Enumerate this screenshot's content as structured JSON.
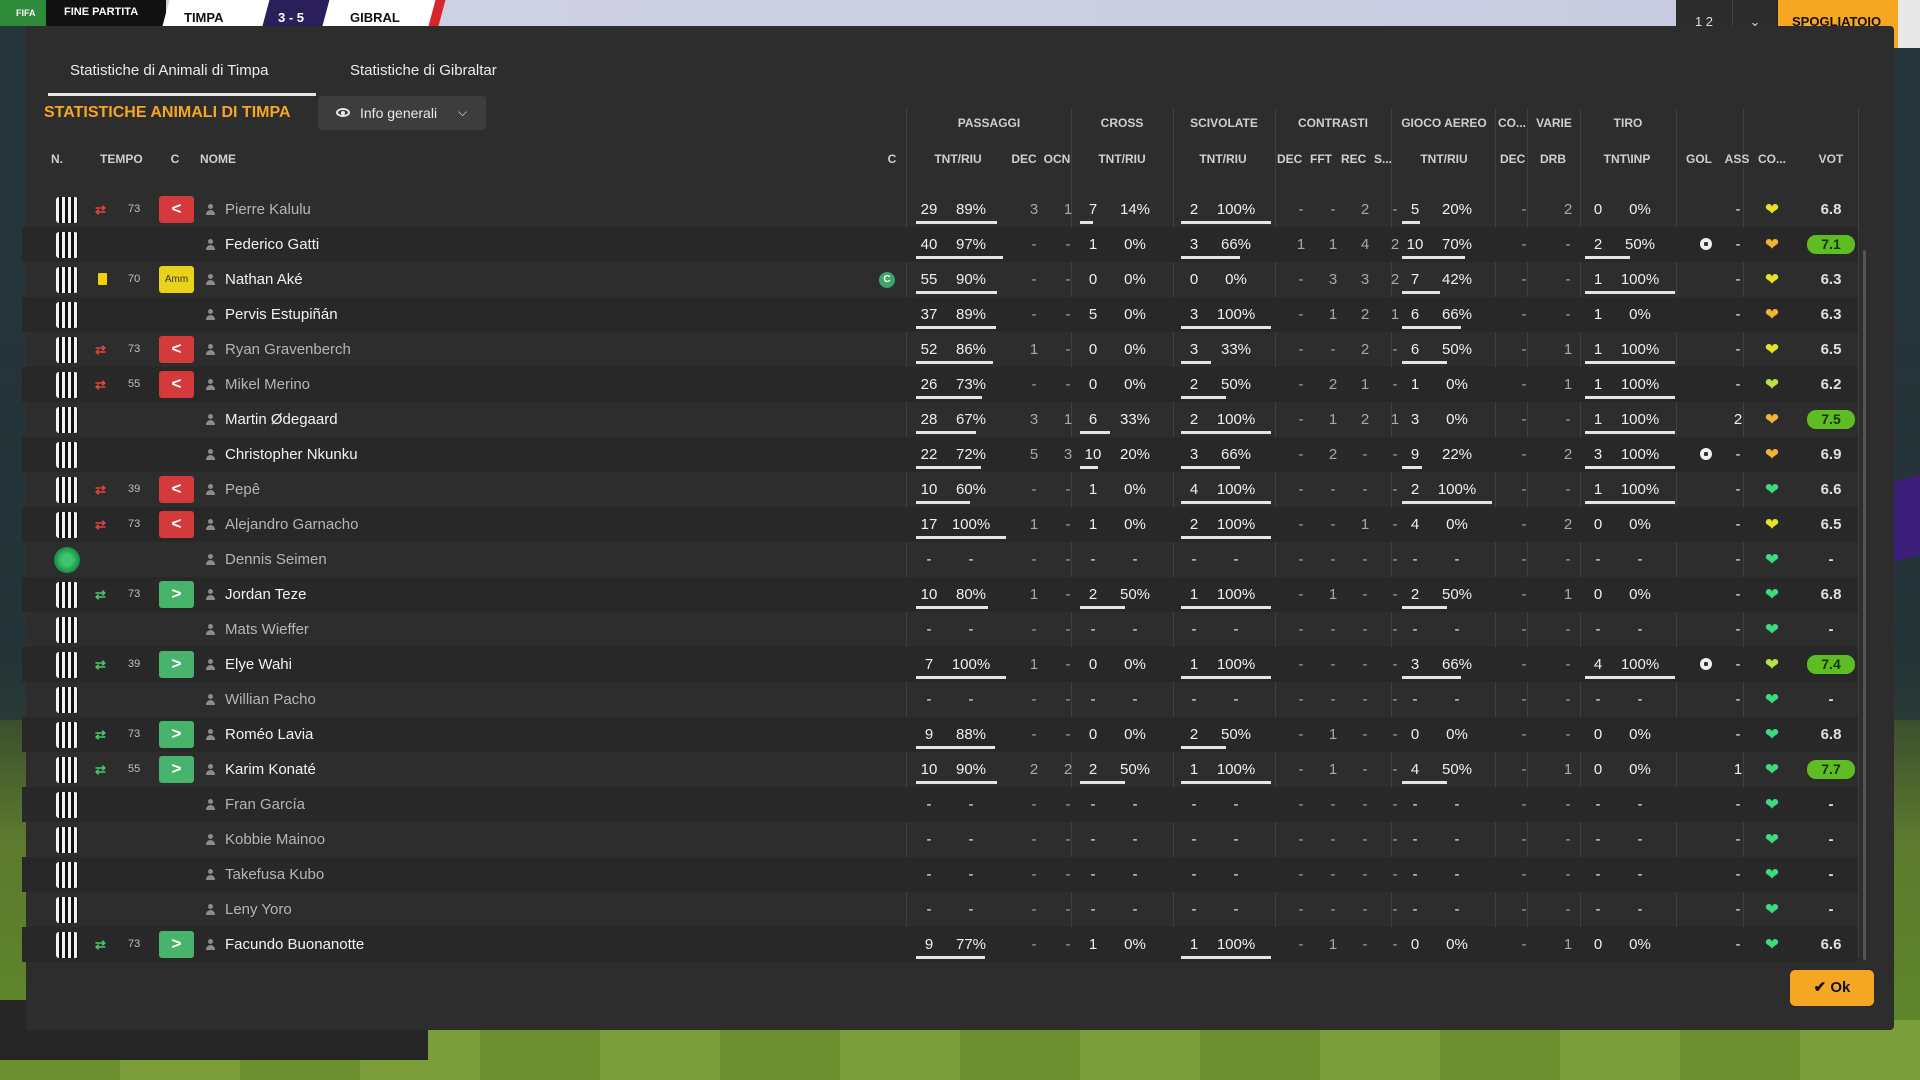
{
  "topbar": {
    "left_label": "FINE PARTITA",
    "fifa_label": "FIFA",
    "home_abbr": "TIMPA",
    "score": "3 - 5",
    "away_abbr": "GIBRAL",
    "right_box1": "1 2",
    "right_box2": "⌄",
    "orange_label": "SPOGLIATOIO"
  },
  "tabs": [
    {
      "label": "Statistiche di Animali di Timpa",
      "active": true
    },
    {
      "label": "Statistiche di Gibraltar",
      "active": false
    }
  ],
  "title": "STATISTICHE ANIMALI DI TIMPA",
  "view_dropdown": {
    "label": "Info generali",
    "icon": "eye-icon"
  },
  "groups": [
    "PASSAGGI",
    "CROSS",
    "SCIVOLATE",
    "CONTRASTI",
    "GIOCO AEREO",
    "CO...",
    "VARIE",
    "TIRO"
  ],
  "headers": {
    "n": "N.",
    "tempo": "TEMPO",
    "c": "C",
    "nome": "NOME",
    "c2": "C",
    "pass_tnt": "TNT/RIU",
    "dec": "DEC",
    "ocn": "OCN",
    "cross_tnt": "TNT/RIU",
    "sciv_tnt": "TNT/RIU",
    "con_dec": "DEC",
    "fft": "FFT",
    "rec": "REC",
    "s": "S...",
    "aereo_tnt": "TNT/RIU",
    "co_dec": "DEC",
    "drb": "DRB",
    "tiro": "TNT\\INP",
    "gol": "GOL",
    "ass": "ASS",
    "co": "CO...",
    "vot": "VOT"
  },
  "colors": {
    "accent": "#f5a623",
    "sub_out": "#d4393c",
    "sub_in": "#48b36a",
    "rating_hi": "#5fbd24"
  },
  "players": [
    {
      "name": "Pierre Kalulu",
      "sub": "out",
      "min": "73",
      "badge": "<",
      "card": "",
      "cap": false,
      "p": [
        "29",
        "89%"
      ],
      "dec": "3",
      "ocn": "1",
      "cr": [
        "7",
        "14%"
      ],
      "sc": [
        "2",
        "100%"
      ],
      "ct": [
        "-",
        "-",
        "2",
        "-"
      ],
      "ae": [
        "5",
        "20%"
      ],
      "codec": "-",
      "drb": "2",
      "ti": [
        "0",
        "0%"
      ],
      "gol": "",
      "ass": "-",
      "heart": "yellow",
      "vot": "6.8",
      "hi": false,
      "pb": 0.9,
      "cb": 0.14,
      "sb": 1,
      "ab": 0.2,
      "tb": 0,
      "kit": "stripes"
    },
    {
      "name": "Federico Gatti",
      "sub": "",
      "min": "",
      "badge": "",
      "card": "",
      "cap": false,
      "p": [
        "40",
        "97%"
      ],
      "dec": "-",
      "ocn": "-",
      "cr": [
        "1",
        "0%"
      ],
      "sc": [
        "3",
        "66%"
      ],
      "ct": [
        "1",
        "1",
        "4",
        "2"
      ],
      "ae": [
        "10",
        "70%"
      ],
      "codec": "-",
      "drb": "-",
      "ti": [
        "2",
        "50%"
      ],
      "gol": "ball",
      "ass": "-",
      "heart": "orange",
      "vot": "7.1",
      "hi": true,
      "pb": 0.97,
      "cb": 0,
      "sb": 0.66,
      "ab": 0.7,
      "tb": 0.5,
      "kit": "stripes"
    },
    {
      "name": "Nathan Aké",
      "sub": "",
      "min": "70",
      "badge": "Amm",
      "card": "yellow",
      "cap": true,
      "p": [
        "55",
        "90%"
      ],
      "dec": "-",
      "ocn": "-",
      "cr": [
        "0",
        "0%"
      ],
      "sc": [
        "0",
        "0%"
      ],
      "ct": [
        "-",
        "3",
        "3",
        "2"
      ],
      "ae": [
        "7",
        "42%"
      ],
      "codec": "-",
      "drb": "-",
      "ti": [
        "1",
        "100%"
      ],
      "gol": "",
      "ass": "-",
      "heart": "yellow",
      "vot": "6.3",
      "hi": false,
      "pb": 0.9,
      "cb": 0,
      "sb": 0,
      "ab": 0.42,
      "tb": 1,
      "kit": "stripes"
    },
    {
      "name": "Pervis Estupiñán",
      "sub": "",
      "min": "",
      "badge": "",
      "card": "",
      "cap": false,
      "p": [
        "37",
        "89%"
      ],
      "dec": "-",
      "ocn": "-",
      "cr": [
        "5",
        "0%"
      ],
      "sc": [
        "3",
        "100%"
      ],
      "ct": [
        "-",
        "1",
        "2",
        "1"
      ],
      "ae": [
        "6",
        "66%"
      ],
      "codec": "-",
      "drb": "-",
      "ti": [
        "1",
        "0%"
      ],
      "gol": "",
      "ass": "-",
      "heart": "orange",
      "vot": "6.3",
      "hi": false,
      "pb": 0.89,
      "cb": 0,
      "sb": 1,
      "ab": 0.66,
      "tb": 0,
      "kit": "stripes"
    },
    {
      "name": "Ryan Gravenberch",
      "sub": "out",
      "min": "73",
      "badge": "<",
      "card": "",
      "cap": false,
      "p": [
        "52",
        "86%"
      ],
      "dec": "1",
      "ocn": "-",
      "cr": [
        "0",
        "0%"
      ],
      "sc": [
        "3",
        "33%"
      ],
      "ct": [
        "-",
        "-",
        "2",
        "-"
      ],
      "ae": [
        "6",
        "50%"
      ],
      "codec": "-",
      "drb": "1",
      "ti": [
        "1",
        "100%"
      ],
      "gol": "",
      "ass": "-",
      "heart": "yellow",
      "vot": "6.5",
      "hi": false,
      "pb": 0.86,
      "cb": 0,
      "sb": 0.33,
      "ab": 0.5,
      "tb": 1,
      "kit": "stripes"
    },
    {
      "name": "Mikel Merino",
      "sub": "out",
      "min": "55",
      "badge": "<",
      "card": "",
      "cap": false,
      "p": [
        "26",
        "73%"
      ],
      "dec": "-",
      "ocn": "-",
      "cr": [
        "0",
        "0%"
      ],
      "sc": [
        "2",
        "50%"
      ],
      "ct": [
        "-",
        "2",
        "1",
        "-"
      ],
      "ae": [
        "1",
        "0%"
      ],
      "codec": "-",
      "drb": "1",
      "ti": [
        "1",
        "100%"
      ],
      "gol": "",
      "ass": "-",
      "heart": "yellowgreen",
      "vot": "6.2",
      "hi": false,
      "pb": 0.73,
      "cb": 0,
      "sb": 0.5,
      "ab": 0,
      "tb": 1,
      "kit": "stripes"
    },
    {
      "name": "Martin Ødegaard",
      "sub": "",
      "min": "",
      "badge": "",
      "card": "",
      "cap": false,
      "p": [
        "28",
        "67%"
      ],
      "dec": "3",
      "ocn": "1",
      "cr": [
        "6",
        "33%"
      ],
      "sc": [
        "2",
        "100%"
      ],
      "ct": [
        "-",
        "1",
        "2",
        "1"
      ],
      "ae": [
        "3",
        "0%"
      ],
      "codec": "-",
      "drb": "-",
      "ti": [
        "1",
        "100%"
      ],
      "gol": "",
      "ass": "2",
      "heart": "orange",
      "vot": "7.5",
      "hi": true,
      "pb": 0.67,
      "cb": 0.33,
      "sb": 1,
      "ab": 0,
      "tb": 1,
      "kit": "stripes"
    },
    {
      "name": "Christopher Nkunku",
      "sub": "",
      "min": "",
      "badge": "",
      "card": "",
      "cap": false,
      "p": [
        "22",
        "72%"
      ],
      "dec": "5",
      "ocn": "3",
      "cr": [
        "10",
        "20%"
      ],
      "sc": [
        "3",
        "66%"
      ],
      "ct": [
        "-",
        "2",
        "-",
        "-"
      ],
      "ae": [
        "9",
        "22%"
      ],
      "codec": "-",
      "drb": "2",
      "ti": [
        "3",
        "100%"
      ],
      "gol": "ball",
      "ass": "-",
      "heart": "orange",
      "vot": "6.9",
      "hi": false,
      "pb": 0.72,
      "cb": 0.2,
      "sb": 0.66,
      "ab": 0.22,
      "tb": 1,
      "kit": "stripes"
    },
    {
      "name": "Pepê",
      "sub": "out",
      "min": "39",
      "badge": "<",
      "card": "",
      "cap": false,
      "p": [
        "10",
        "60%"
      ],
      "dec": "-",
      "ocn": "-",
      "cr": [
        "1",
        "0%"
      ],
      "sc": [
        "4",
        "100%"
      ],
      "ct": [
        "-",
        "-",
        "-",
        "-"
      ],
      "ae": [
        "2",
        "100%"
      ],
      "codec": "-",
      "drb": "-",
      "ti": [
        "1",
        "100%"
      ],
      "gol": "",
      "ass": "-",
      "heart": "green",
      "vot": "6.6",
      "hi": false,
      "pb": 0.6,
      "cb": 0,
      "sb": 1,
      "ab": 1,
      "tb": 1,
      "kit": "stripes"
    },
    {
      "name": "Alejandro Garnacho",
      "sub": "out",
      "min": "73",
      "badge": "<",
      "card": "",
      "cap": false,
      "p": [
        "17",
        "100%"
      ],
      "dec": "1",
      "ocn": "-",
      "cr": [
        "1",
        "0%"
      ],
      "sc": [
        "2",
        "100%"
      ],
      "ct": [
        "-",
        "-",
        "1",
        "-"
      ],
      "ae": [
        "4",
        "0%"
      ],
      "codec": "-",
      "drb": "2",
      "ti": [
        "0",
        "0%"
      ],
      "gol": "",
      "ass": "-",
      "heart": "yellow",
      "vot": "6.5",
      "hi": false,
      "pb": 1,
      "cb": 0,
      "sb": 1,
      "ab": 0,
      "tb": 0,
      "kit": "stripes"
    },
    {
      "name": "Dennis Seimen",
      "sub": "",
      "min": "",
      "badge": "",
      "card": "",
      "cap": false,
      "p": [
        "-",
        "-"
      ],
      "dec": "-",
      "ocn": "-",
      "cr": [
        "-",
        "-"
      ],
      "sc": [
        "-",
        "-"
      ],
      "ct": [
        "-",
        "-",
        "-",
        "-"
      ],
      "ae": [
        "-",
        "-"
      ],
      "codec": "-",
      "drb": "-",
      "ti": [
        "-",
        "-"
      ],
      "gol": "",
      "ass": "-",
      "heart": "green",
      "vot": "-",
      "hi": false,
      "pb": 0,
      "cb": 0,
      "sb": 0,
      "ab": 0,
      "tb": 0,
      "kit": "gk",
      "dimname": true
    },
    {
      "name": "Jordan Teze",
      "sub": "in",
      "min": "73",
      "badge": ">",
      "card": "",
      "cap": false,
      "p": [
        "10",
        "80%"
      ],
      "dec": "1",
      "ocn": "-",
      "cr": [
        "2",
        "50%"
      ],
      "sc": [
        "1",
        "100%"
      ],
      "ct": [
        "-",
        "1",
        "-",
        "-"
      ],
      "ae": [
        "2",
        "50%"
      ],
      "codec": "-",
      "drb": "1",
      "ti": [
        "0",
        "0%"
      ],
      "gol": "",
      "ass": "-",
      "heart": "green",
      "vot": "6.8",
      "hi": false,
      "pb": 0.8,
      "cb": 0.5,
      "sb": 1,
      "ab": 0.5,
      "tb": 0,
      "kit": "stripes"
    },
    {
      "name": "Mats Wieffer",
      "sub": "",
      "min": "",
      "badge": "",
      "card": "",
      "cap": false,
      "p": [
        "-",
        "-"
      ],
      "dec": "-",
      "ocn": "-",
      "cr": [
        "-",
        "-"
      ],
      "sc": [
        "-",
        "-"
      ],
      "ct": [
        "-",
        "-",
        "-",
        "-"
      ],
      "ae": [
        "-",
        "-"
      ],
      "codec": "-",
      "drb": "-",
      "ti": [
        "-",
        "-"
      ],
      "gol": "",
      "ass": "-",
      "heart": "green",
      "vot": "-",
      "hi": false,
      "pb": 0,
      "cb": 0,
      "sb": 0,
      "ab": 0,
      "tb": 0,
      "kit": "stripes",
      "dimname": true
    },
    {
      "name": "Elye Wahi",
      "sub": "in",
      "min": "39",
      "badge": ">",
      "card": "",
      "cap": false,
      "p": [
        "7",
        "100%"
      ],
      "dec": "1",
      "ocn": "-",
      "cr": [
        "0",
        "0%"
      ],
      "sc": [
        "1",
        "100%"
      ],
      "ct": [
        "-",
        "-",
        "-",
        "-"
      ],
      "ae": [
        "3",
        "66%"
      ],
      "codec": "-",
      "drb": "-",
      "ti": [
        "4",
        "100%"
      ],
      "gol": "ball",
      "ass": "-",
      "heart": "yellowgreen",
      "vot": "7.4",
      "hi": true,
      "pb": 1,
      "cb": 0,
      "sb": 1,
      "ab": 0.66,
      "tb": 1,
      "kit": "stripes"
    },
    {
      "name": "Willian Pacho",
      "sub": "",
      "min": "",
      "badge": "",
      "card": "",
      "cap": false,
      "p": [
        "-",
        "-"
      ],
      "dec": "-",
      "ocn": "-",
      "cr": [
        "-",
        "-"
      ],
      "sc": [
        "-",
        "-"
      ],
      "ct": [
        "-",
        "-",
        "-",
        "-"
      ],
      "ae": [
        "-",
        "-"
      ],
      "codec": "-",
      "drb": "-",
      "ti": [
        "-",
        "-"
      ],
      "gol": "",
      "ass": "-",
      "heart": "green",
      "vot": "-",
      "hi": false,
      "pb": 0,
      "cb": 0,
      "sb": 0,
      "ab": 0,
      "tb": 0,
      "kit": "stripes",
      "dimname": true
    },
    {
      "name": "Roméo Lavia",
      "sub": "in",
      "min": "73",
      "badge": ">",
      "card": "",
      "cap": false,
      "p": [
        "9",
        "88%"
      ],
      "dec": "-",
      "ocn": "-",
      "cr": [
        "0",
        "0%"
      ],
      "sc": [
        "2",
        "50%"
      ],
      "ct": [
        "-",
        "1",
        "-",
        "-"
      ],
      "ae": [
        "0",
        "0%"
      ],
      "codec": "-",
      "drb": "-",
      "ti": [
        "0",
        "0%"
      ],
      "gol": "",
      "ass": "-",
      "heart": "green",
      "vot": "6.8",
      "hi": false,
      "pb": 0.88,
      "cb": 0,
      "sb": 0.5,
      "ab": 0,
      "tb": 0,
      "kit": "stripes"
    },
    {
      "name": "Karim Konaté",
      "sub": "in",
      "min": "55",
      "badge": ">",
      "card": "",
      "cap": false,
      "p": [
        "10",
        "90%"
      ],
      "dec": "2",
      "ocn": "2",
      "cr": [
        "2",
        "50%"
      ],
      "sc": [
        "1",
        "100%"
      ],
      "ct": [
        "-",
        "1",
        "-",
        "-"
      ],
      "ae": [
        "4",
        "50%"
      ],
      "codec": "-",
      "drb": "1",
      "ti": [
        "0",
        "0%"
      ],
      "gol": "",
      "ass": "1",
      "heart": "green",
      "vot": "7.7",
      "hi": true,
      "pb": 0.9,
      "cb": 0.5,
      "sb": 1,
      "ab": 0.5,
      "tb": 0,
      "kit": "stripes"
    },
    {
      "name": "Fran García",
      "sub": "",
      "min": "",
      "badge": "",
      "card": "",
      "cap": false,
      "p": [
        "-",
        "-"
      ],
      "dec": "-",
      "ocn": "-",
      "cr": [
        "-",
        "-"
      ],
      "sc": [
        "-",
        "-"
      ],
      "ct": [
        "-",
        "-",
        "-",
        "-"
      ],
      "ae": [
        "-",
        "-"
      ],
      "codec": "-",
      "drb": "-",
      "ti": [
        "-",
        "-"
      ],
      "gol": "",
      "ass": "-",
      "heart": "green",
      "vot": "-",
      "hi": false,
      "pb": 0,
      "cb": 0,
      "sb": 0,
      "ab": 0,
      "tb": 0,
      "kit": "stripes",
      "dimname": true
    },
    {
      "name": "Kobbie Mainoo",
      "sub": "",
      "min": "",
      "badge": "",
      "card": "",
      "cap": false,
      "p": [
        "-",
        "-"
      ],
      "dec": "-",
      "ocn": "-",
      "cr": [
        "-",
        "-"
      ],
      "sc": [
        "-",
        "-"
      ],
      "ct": [
        "-",
        "-",
        "-",
        "-"
      ],
      "ae": [
        "-",
        "-"
      ],
      "codec": "-",
      "drb": "-",
      "ti": [
        "-",
        "-"
      ],
      "gol": "",
      "ass": "-",
      "heart": "green",
      "vot": "-",
      "hi": false,
      "pb": 0,
      "cb": 0,
      "sb": 0,
      "ab": 0,
      "tb": 0,
      "kit": "stripes",
      "dimname": true
    },
    {
      "name": "Takefusa Kubo",
      "sub": "",
      "min": "",
      "badge": "",
      "card": "",
      "cap": false,
      "p": [
        "-",
        "-"
      ],
      "dec": "-",
      "ocn": "-",
      "cr": [
        "-",
        "-"
      ],
      "sc": [
        "-",
        "-"
      ],
      "ct": [
        "-",
        "-",
        "-",
        "-"
      ],
      "ae": [
        "-",
        "-"
      ],
      "codec": "-",
      "drb": "-",
      "ti": [
        "-",
        "-"
      ],
      "gol": "",
      "ass": "-",
      "heart": "green",
      "vot": "-",
      "hi": false,
      "pb": 0,
      "cb": 0,
      "sb": 0,
      "ab": 0,
      "tb": 0,
      "kit": "stripes",
      "dimname": true
    },
    {
      "name": "Leny Yoro",
      "sub": "",
      "min": "",
      "badge": "",
      "card": "",
      "cap": false,
      "p": [
        "-",
        "-"
      ],
      "dec": "-",
      "ocn": "-",
      "cr": [
        "-",
        "-"
      ],
      "sc": [
        "-",
        "-"
      ],
      "ct": [
        "-",
        "-",
        "-",
        "-"
      ],
      "ae": [
        "-",
        "-"
      ],
      "codec": "-",
      "drb": "-",
      "ti": [
        "-",
        "-"
      ],
      "gol": "",
      "ass": "-",
      "heart": "green",
      "vot": "-",
      "hi": false,
      "pb": 0,
      "cb": 0,
      "sb": 0,
      "ab": 0,
      "tb": 0,
      "kit": "stripes",
      "dimname": true
    },
    {
      "name": "Facundo Buonanotte",
      "sub": "in",
      "min": "73",
      "badge": ">",
      "card": "",
      "cap": false,
      "p": [
        "9",
        "77%"
      ],
      "dec": "-",
      "ocn": "-",
      "cr": [
        "1",
        "0%"
      ],
      "sc": [
        "1",
        "100%"
      ],
      "ct": [
        "-",
        "1",
        "-",
        "-"
      ],
      "ae": [
        "0",
        "0%"
      ],
      "codec": "-",
      "drb": "1",
      "ti": [
        "0",
        "0%"
      ],
      "gol": "",
      "ass": "-",
      "heart": "green",
      "vot": "6.6",
      "hi": false,
      "pb": 0.77,
      "cb": 0,
      "sb": 1,
      "ab": 0,
      "tb": 0,
      "kit": "stripes"
    }
  ],
  "ok_button": "Ok"
}
